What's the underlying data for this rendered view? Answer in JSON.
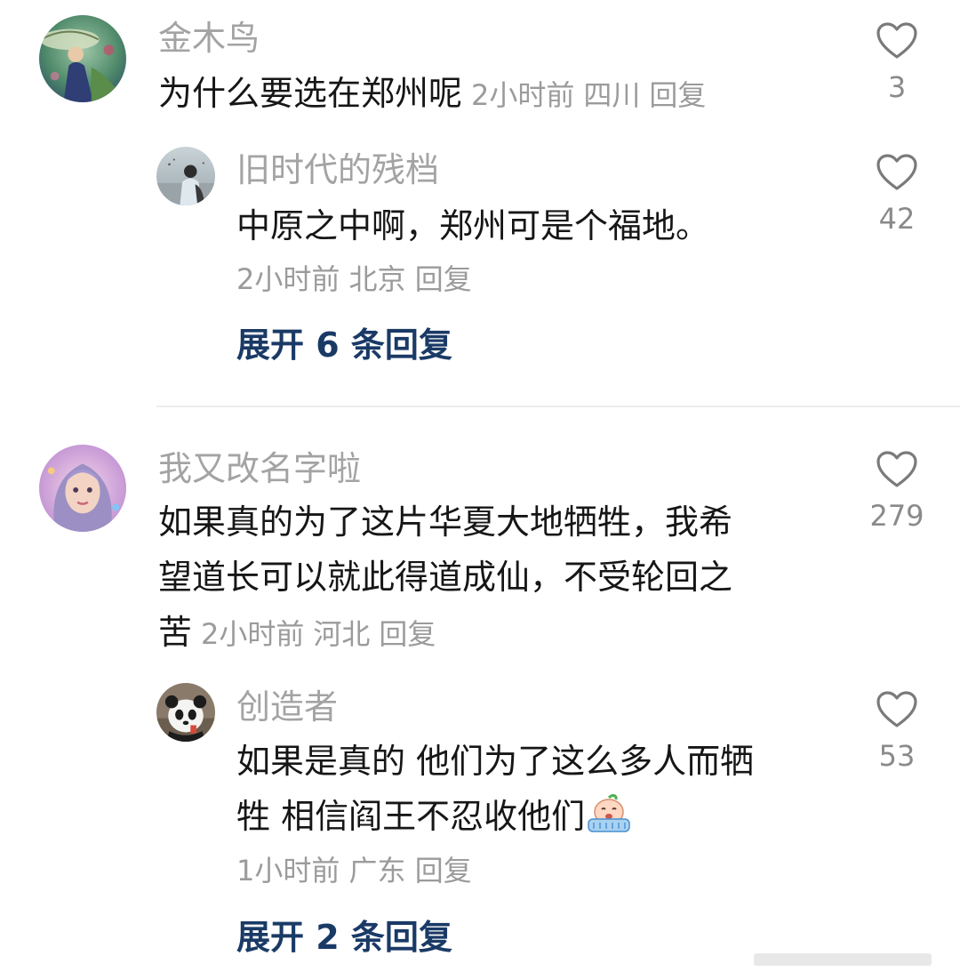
{
  "comments": [
    {
      "username": "金木鸟",
      "text": "为什么要选在郑州呢",
      "time": "2小时前",
      "location": "四川",
      "reply": "回复",
      "likes": "3",
      "replies": [
        {
          "username": "旧时代的残档",
          "text": "中原之中啊，郑州可是个福地。",
          "time": "2小时前",
          "location": "北京",
          "reply": "回复",
          "likes": "42"
        }
      ],
      "expand": "展开 6 条回复"
    },
    {
      "username": "我又改名字啦",
      "text_line1": "如果真的为了这片华夏大地牺牲，我希",
      "text_line2": "望道长可以就此得道成仙，不受轮回之",
      "text_line3": "苦",
      "time": "2小时前",
      "location": "河北",
      "reply": "回复",
      "likes": "279",
      "replies": [
        {
          "username": "创造者",
          "text_line1": "如果是真的 他们为了这么多人而牺",
          "text_line2": "牲 相信阎王不忍收他们",
          "emoji": "crying-face-emoji",
          "time": "1小时前",
          "location": "广东",
          "reply": "回复",
          "likes": "53"
        }
      ],
      "expand": "展开 2 条回复"
    }
  ],
  "colors": {
    "username": "#a3a3a3",
    "text": "#161616",
    "meta": "#9b9b9b",
    "expand_link": "#1a3a66",
    "heart_outline": "#7a7a7a"
  }
}
